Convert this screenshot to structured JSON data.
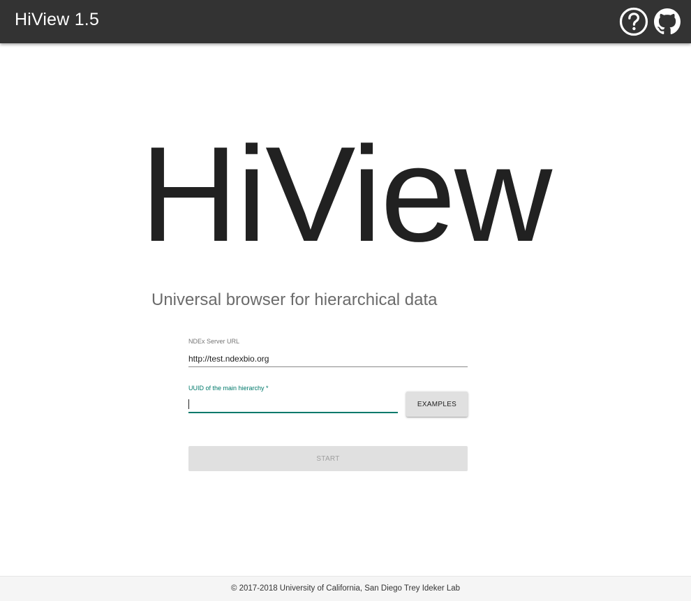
{
  "appbar": {
    "title": "HiView 1.5",
    "help_icon": "help-circle-icon",
    "github_icon": "github-icon"
  },
  "hero": {
    "title": "HiView",
    "subtitle": "Universal browser for hierarchical data"
  },
  "form": {
    "server_label": "NDEx Server URL",
    "server_value": "http://test.ndexbio.org",
    "uuid_label": "UUID of the main hierarchy *",
    "uuid_value": "",
    "examples_label": "EXAMPLES",
    "start_label": "START"
  },
  "footer": {
    "text": "© 2017-2018 University of California, San Diego Trey Ideker Lab"
  },
  "colors": {
    "appbar": "#333333",
    "accent": "#00796b",
    "button": "#e0e0e0",
    "footer": "#f5f5f5"
  }
}
